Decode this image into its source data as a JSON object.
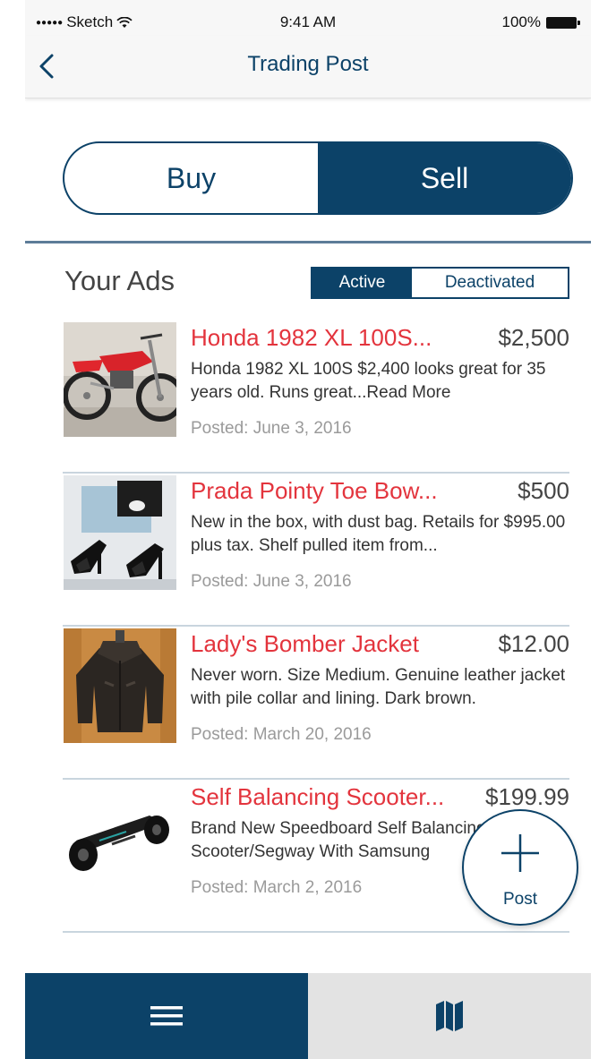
{
  "status_bar": {
    "carrier": "Sketch",
    "time": "9:41 AM",
    "battery": "100%"
  },
  "nav": {
    "title": "Trading Post",
    "back_icon": "chevron-left-icon"
  },
  "segment": {
    "options": [
      "Buy",
      "Sell"
    ],
    "selected": "Sell"
  },
  "section": {
    "title": "Your Ads",
    "filters": [
      "Active",
      "Deactivated"
    ],
    "selected_filter": "Active"
  },
  "ads": [
    {
      "title": "Honda 1982 XL 100S...",
      "price": "$2,500",
      "description": "Honda 1982 XL 100S $2,400 looks great for 35 years old.  Runs great...Read More",
      "posted": "Posted: June 3, 2016",
      "image_icon": "motorcycle-photo"
    },
    {
      "title": "Prada Pointy Toe Bow...",
      "price": "$500",
      "description": "New in the box, with dust bag. Retails for $995.00 plus tax. Shelf pulled item from...",
      "posted": "Posted: June 3, 2016",
      "image_icon": "shoes-photo"
    },
    {
      "title": "Lady's Bomber Jacket",
      "price": "$12.00",
      "description": "Never worn. Size Medium. Genuine leather jacket with pile collar and lining. Dark brown.",
      "posted": "Posted: March 20, 2016",
      "image_icon": "jacket-photo"
    },
    {
      "title": "Self Balancing Scooter...",
      "price": "$199.99",
      "description": "Brand New Speedboard Self Balancing Scooter/Segway With Samsung",
      "posted": "Posted: March 2, 2016",
      "image_icon": "scooter-photo"
    }
  ],
  "fab": {
    "label": "Post",
    "icon": "plus-icon"
  },
  "tabbar": {
    "left_icon": "menu-icon",
    "right_icon": "map-icon"
  },
  "colors": {
    "primary": "#0c4268",
    "accent_red": "#e3343d",
    "divider": "#c9d5de"
  }
}
